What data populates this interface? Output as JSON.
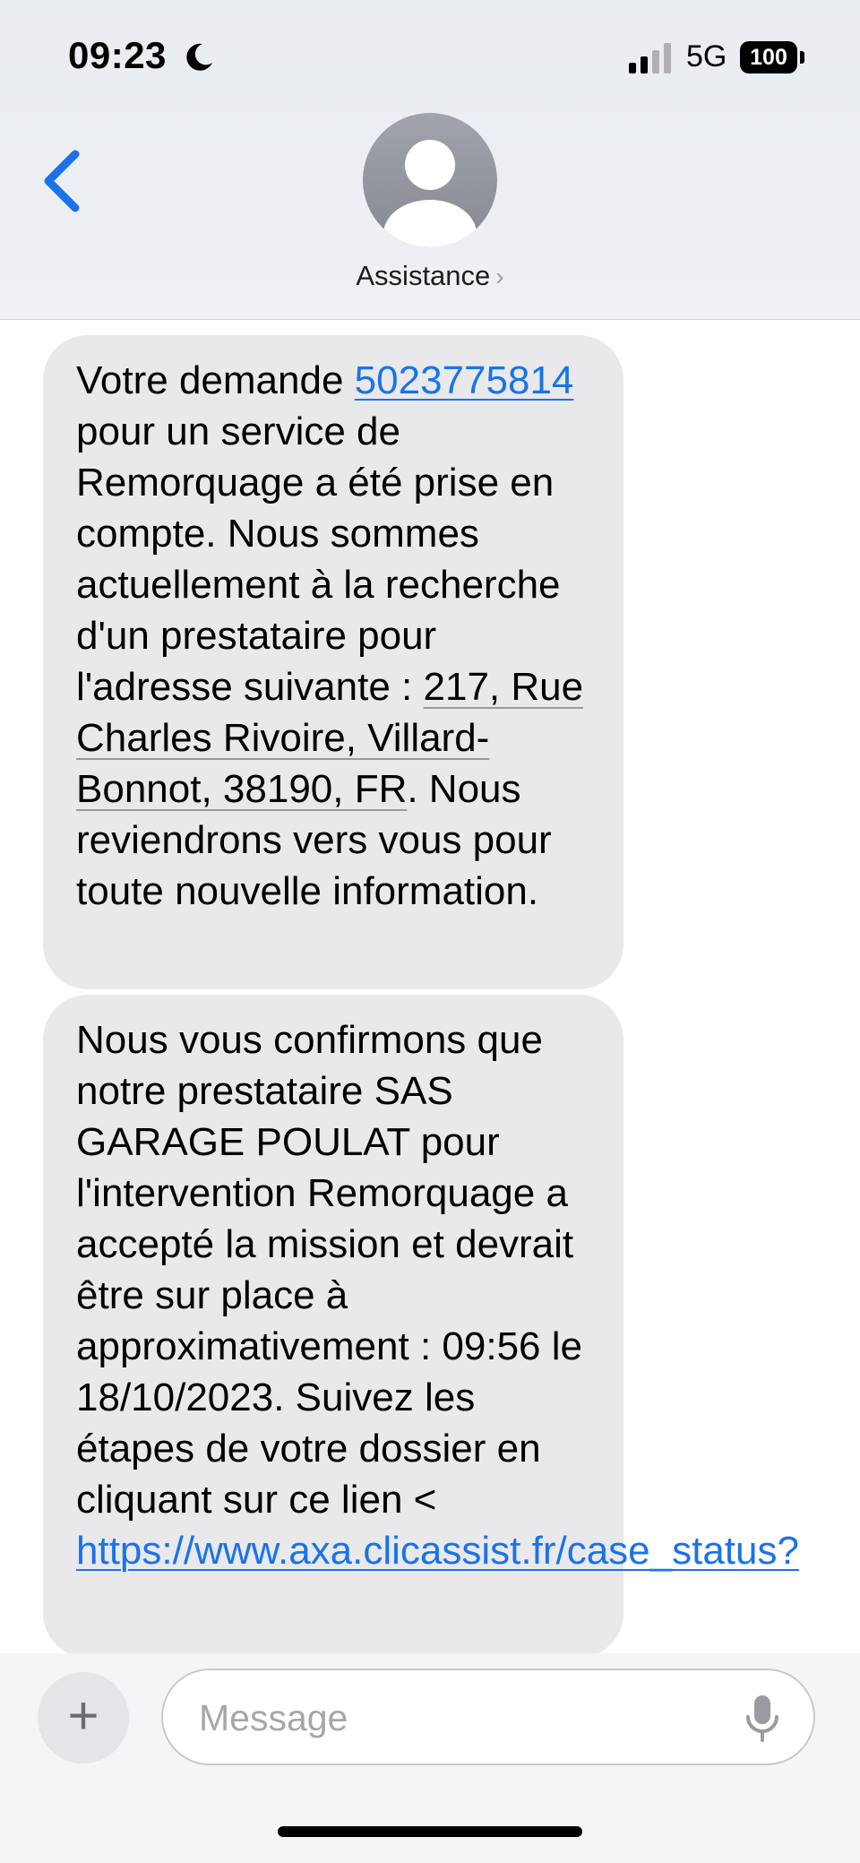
{
  "status_bar": {
    "time": "09:23",
    "network": "5G",
    "battery": "100",
    "icons": [
      "moon-icon",
      "signal-icon",
      "battery-icon"
    ]
  },
  "header": {
    "contact_name": "Assistance",
    "chevron": "›",
    "icons": [
      "back-chevron-icon",
      "contact-avatar-icon"
    ]
  },
  "messages": [
    {
      "parts": [
        "Votre demande ",
        "5023775814",
        " pour un service de Remorquage a été prise en compte. Nous sommes actuellement à la recherche d'un prestataire pour l'adresse suivante : ",
        "217, Rue Charles Rivoire, Villard-Bonnot, 38190, FR",
        ". Nous reviendrons vers vous pour toute nouvelle information."
      ]
    },
    {
      "parts": [
        "Nous vous confirmons que notre prestataire SAS GARAGE POULAT pour l'intervention Remorquage a accepté la mission et devrait être sur place à approximativement : 09:56 le 18/10/2023. Suivez les étapes de votre dossier en cliquant sur ce lien < ",
        "https://www.axa.clicassist.fr/case_status?"
      ]
    }
  ],
  "composer": {
    "plus_label": "+",
    "placeholder": "Message",
    "icons": [
      "plus-icon",
      "microphone-icon"
    ]
  },
  "colors": {
    "link": "#1a73e8",
    "bubble": "#e9e9eb",
    "header_bg": "#eceef2",
    "back_chevron": "#1a73e8"
  }
}
